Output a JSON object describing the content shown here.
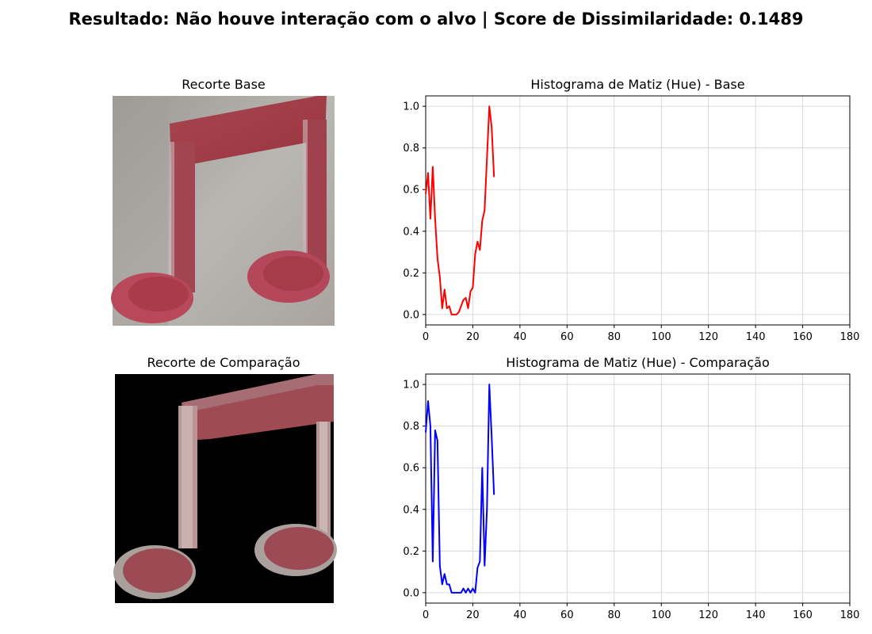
{
  "suptitle": "Resultado: Não houve interação com o alvo | Score de Dissimilaridade: 0.1489",
  "images": {
    "base_title": "Recorte Base",
    "comparison_title": "Recorte de Comparação"
  },
  "chart_data": [
    {
      "type": "line",
      "title": "Histograma de Matiz (Hue) - Base",
      "xlabel": "",
      "ylabel": "",
      "xlim": [
        0,
        180
      ],
      "ylim": [
        -0.05,
        1.05
      ],
      "xticks": [
        0,
        20,
        40,
        60,
        80,
        100,
        120,
        140,
        160,
        180
      ],
      "yticks": [
        0.0,
        0.2,
        0.4,
        0.6,
        0.8,
        1.0
      ],
      "grid": true,
      "color": "#ff0000",
      "series": [
        {
          "x": [
            0,
            1,
            2,
            3,
            4,
            5,
            6,
            7,
            8,
            9,
            10,
            11,
            12,
            13,
            14,
            15,
            16,
            17,
            18,
            19,
            20,
            21,
            22,
            23,
            24,
            25,
            26,
            27,
            28,
            29
          ],
          "y": [
            0.58,
            0.68,
            0.46,
            0.71,
            0.46,
            0.27,
            0.18,
            0.03,
            0.12,
            0.03,
            0.04,
            0.0,
            0.0,
            0.0,
            0.01,
            0.04,
            0.07,
            0.08,
            0.03,
            0.11,
            0.13,
            0.29,
            0.35,
            0.31,
            0.45,
            0.5,
            0.75,
            1.0,
            0.9,
            0.66
          ]
        }
      ]
    },
    {
      "type": "line",
      "title": "Histograma de Matiz (Hue) - Comparação",
      "xlabel": "",
      "ylabel": "",
      "xlim": [
        0,
        180
      ],
      "ylim": [
        -0.05,
        1.05
      ],
      "xticks": [
        0,
        20,
        40,
        60,
        80,
        100,
        120,
        140,
        160,
        180
      ],
      "yticks": [
        0.0,
        0.2,
        0.4,
        0.6,
        0.8,
        1.0
      ],
      "grid": true,
      "color": "#0000ff",
      "series": [
        {
          "x": [
            0,
            1,
            2,
            3,
            4,
            5,
            6,
            7,
            8,
            9,
            10,
            11,
            12,
            13,
            14,
            15,
            16,
            17,
            18,
            19,
            20,
            21,
            22,
            23,
            24,
            25,
            26,
            27,
            28,
            29
          ],
          "y": [
            0.77,
            0.92,
            0.8,
            0.15,
            0.78,
            0.73,
            0.13,
            0.04,
            0.09,
            0.04,
            0.04,
            0.0,
            0.0,
            0.0,
            0.0,
            0.0,
            0.02,
            0.0,
            0.02,
            0.0,
            0.02,
            0.0,
            0.12,
            0.15,
            0.6,
            0.13,
            0.4,
            1.0,
            0.75,
            0.47
          ]
        }
      ]
    }
  ]
}
